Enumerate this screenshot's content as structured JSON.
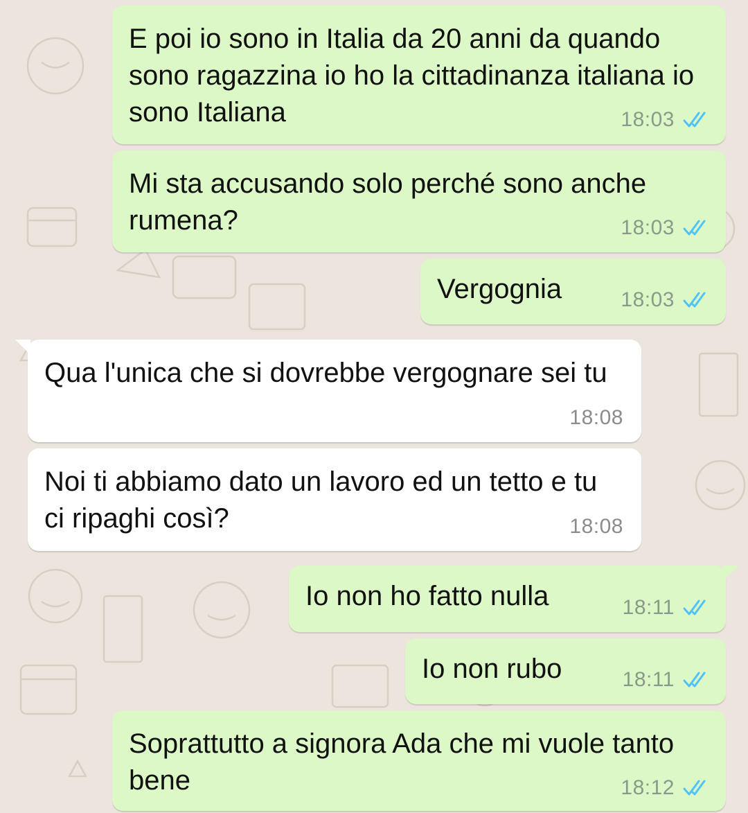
{
  "colors": {
    "wallpaper": "#ece5dd",
    "outgoing_bubble": "#dcf8c6",
    "incoming_bubble": "#ffffff",
    "read_ticks": "#4fc3f7"
  },
  "messages": [
    {
      "direction": "outgoing",
      "text": "E poi io sono in Italia da 20 anni da quando sono ragazzina io ho la cittadinanza italiana io sono Italiana",
      "time": "18:03",
      "status_icon": "double-check-read-icon"
    },
    {
      "direction": "outgoing",
      "text": "Mi sta accusando solo perché sono anche rumena?",
      "time": "18:03",
      "status_icon": "double-check-read-icon"
    },
    {
      "direction": "outgoing",
      "text": "Vergognia",
      "time": "18:03",
      "status_icon": "double-check-read-icon"
    },
    {
      "direction": "incoming",
      "text": "Qua l'unica che si dovrebbe vergognare sei tu",
      "time": "18:08"
    },
    {
      "direction": "incoming",
      "text": "Noi ti abbiamo dato un lavoro ed un tetto e tu ci ripaghi così?",
      "time": "18:08"
    },
    {
      "direction": "outgoing",
      "text": "Io non ho fatto nulla",
      "time": "18:11",
      "status_icon": "double-check-read-icon"
    },
    {
      "direction": "outgoing",
      "text": "Io non rubo",
      "time": "18:11",
      "status_icon": "double-check-read-icon"
    },
    {
      "direction": "outgoing",
      "text": "Soprattutto a signora Ada che mi vuole tanto bene",
      "time": "18:12",
      "status_icon": "double-check-read-icon"
    }
  ]
}
